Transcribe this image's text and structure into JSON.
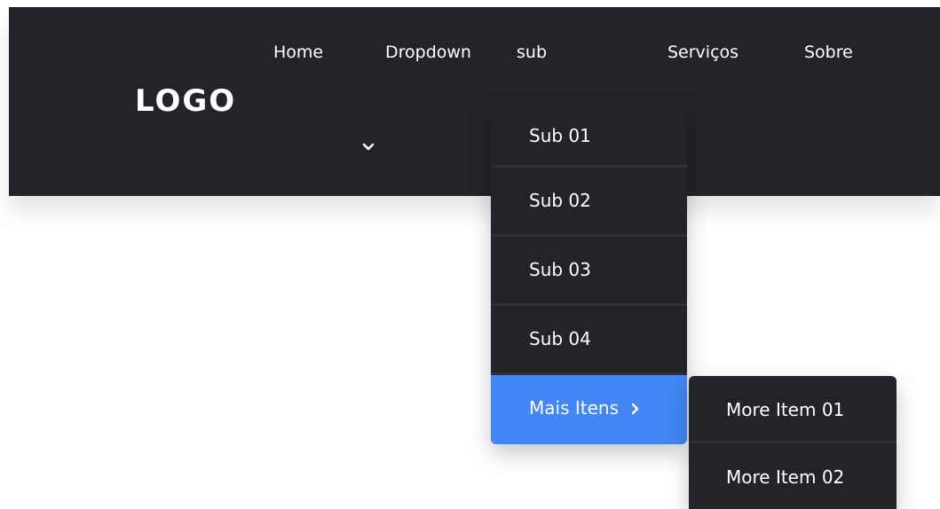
{
  "logo": {
    "text": "LOGO"
  },
  "nav": {
    "home": "Home",
    "dropdown": "Dropdown",
    "sub": "sub",
    "servicos": "Serviços",
    "sobre": "Sobre"
  },
  "dropdown": {
    "items": [
      {
        "label": "Sub 01"
      },
      {
        "label": "Sub 02"
      },
      {
        "label": "Sub 03"
      },
      {
        "label": "Sub 04"
      },
      {
        "label": "Mais Itens"
      }
    ]
  },
  "submenu": {
    "items": [
      {
        "label": "More Item 01"
      },
      {
        "label": "More Item 02"
      }
    ]
  },
  "colors": {
    "navbar_bg": "#23242a",
    "active_item": "#4285f4",
    "text": "#ffffff"
  },
  "icons": {
    "nav_chevron": "chevron-down-icon",
    "submenu_chevron": "chevron-right-icon"
  }
}
